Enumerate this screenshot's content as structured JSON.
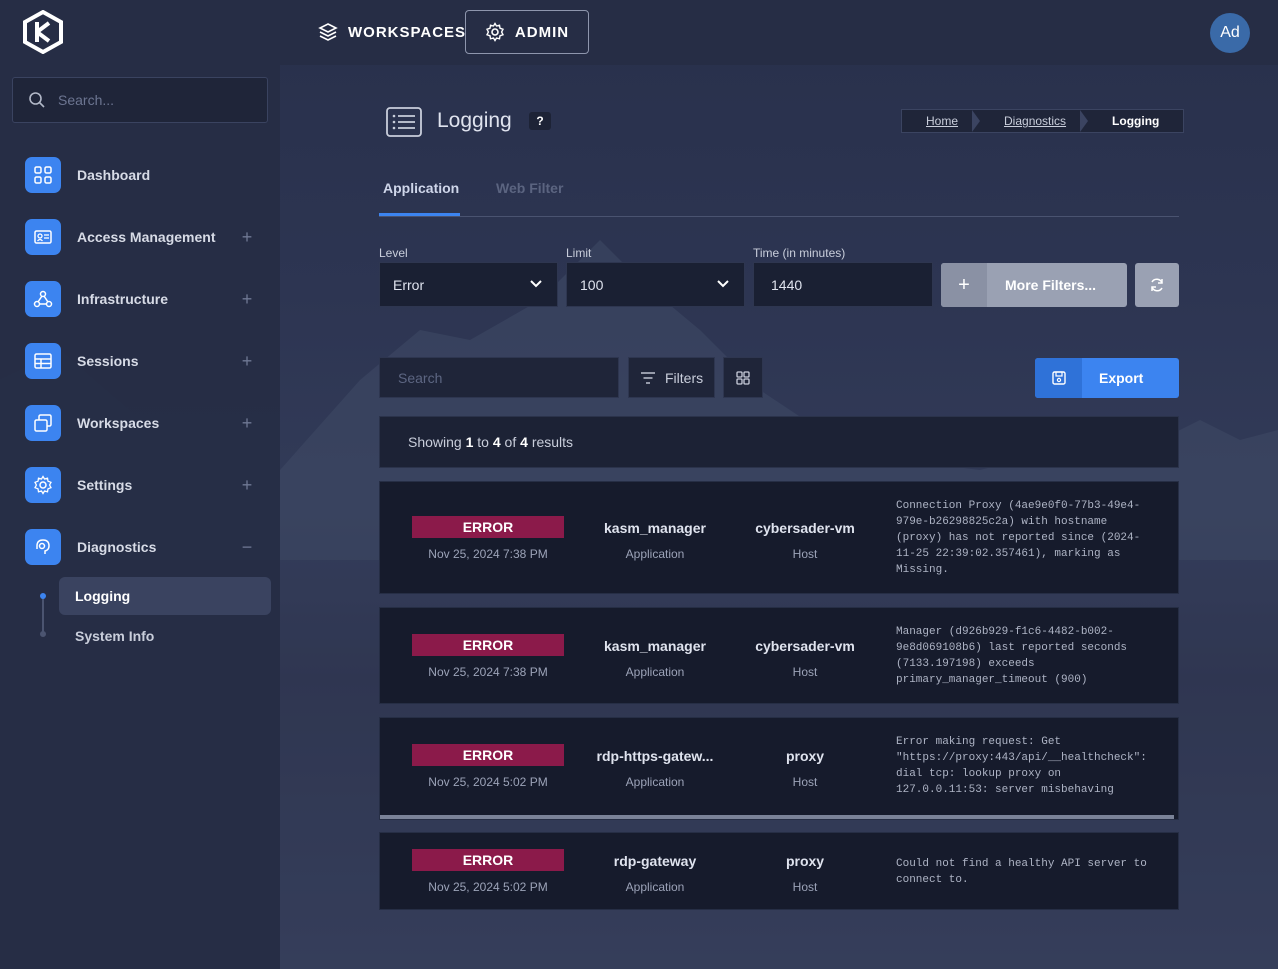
{
  "app": {
    "avatar_initials": "Ad"
  },
  "topnav": {
    "workspaces": "WORKSPACES",
    "admin": "ADMIN"
  },
  "sidebar": {
    "search_placeholder": "Search...",
    "items": [
      {
        "label": "Dashboard",
        "icon": "dashboard-grid-icon"
      },
      {
        "label": "Access Management",
        "icon": "id-card-icon",
        "expand": "+"
      },
      {
        "label": "Infrastructure",
        "icon": "network-icon",
        "expand": "+"
      },
      {
        "label": "Sessions",
        "icon": "table-icon",
        "expand": "+"
      },
      {
        "label": "Workspaces",
        "icon": "windows-icon",
        "expand": "+"
      },
      {
        "label": "Settings",
        "icon": "gear-icon",
        "expand": "+"
      },
      {
        "label": "Diagnostics",
        "icon": "stethoscope-icon",
        "expand": "−"
      }
    ],
    "subitems": [
      {
        "label": "Logging"
      },
      {
        "label": "System Info"
      }
    ]
  },
  "page": {
    "title": "Logging",
    "help": "?",
    "breadcrumb": [
      "Home",
      "Diagnostics",
      "Logging"
    ]
  },
  "tabs": [
    "Application",
    "Web Filter"
  ],
  "filters": {
    "level_label": "Level",
    "level_value": "Error",
    "limit_label": "Limit",
    "limit_value": "100",
    "time_label": "Time (in minutes)",
    "time_value": "1440",
    "more_filters": "More Filters...",
    "plus": "+"
  },
  "toolbar": {
    "search_placeholder": "Search",
    "filters_label": "Filters",
    "export_label": "Export"
  },
  "results": {
    "prefix": "Showing",
    "from": "1",
    "to_word": "to",
    "to": "4",
    "of_word": "of",
    "total": "4",
    "suffix": "results"
  },
  "logs": [
    {
      "level": "ERROR",
      "date": "Nov 25, 2024 7:38 PM",
      "source": "kasm_manager",
      "source_type": "Application",
      "host": "cybersader-vm",
      "host_type": "Host",
      "message": "Connection Proxy (4ae9e0f0-77b3-49e4-979e-b26298825c2a) with hostname (proxy) has not reported since (2024-11-25 22:39:02.357461), marking as Missing."
    },
    {
      "level": "ERROR",
      "date": "Nov 25, 2024 7:38 PM",
      "source": "kasm_manager",
      "source_type": "Application",
      "host": "cybersader-vm",
      "host_type": "Host",
      "message": "Manager (d926b929-f1c6-4482-b002-9e8d069108b6) last reported seconds (7133.197198) exceeds primary_manager_timeout (900)"
    },
    {
      "level": "ERROR",
      "date": "Nov 25, 2024 5:02 PM",
      "source": "rdp-https-gatew...",
      "source_type": "Application",
      "host": "proxy",
      "host_type": "Host",
      "message": "Error making request: Get \"https://proxy:443/api/__healthcheck\": dial tcp: lookup proxy on 127.0.0.11:53: server misbehaving"
    },
    {
      "level": "ERROR",
      "date": "Nov 25, 2024 5:02 PM",
      "source": "rdp-gateway",
      "source_type": "Application",
      "host": "proxy",
      "host_type": "Host",
      "message": "Could not find a healthy API server to connect to."
    }
  ],
  "colors": {
    "accent": "#3c84f0",
    "error_badge": "#8b1a4a",
    "background": "#262d45"
  }
}
